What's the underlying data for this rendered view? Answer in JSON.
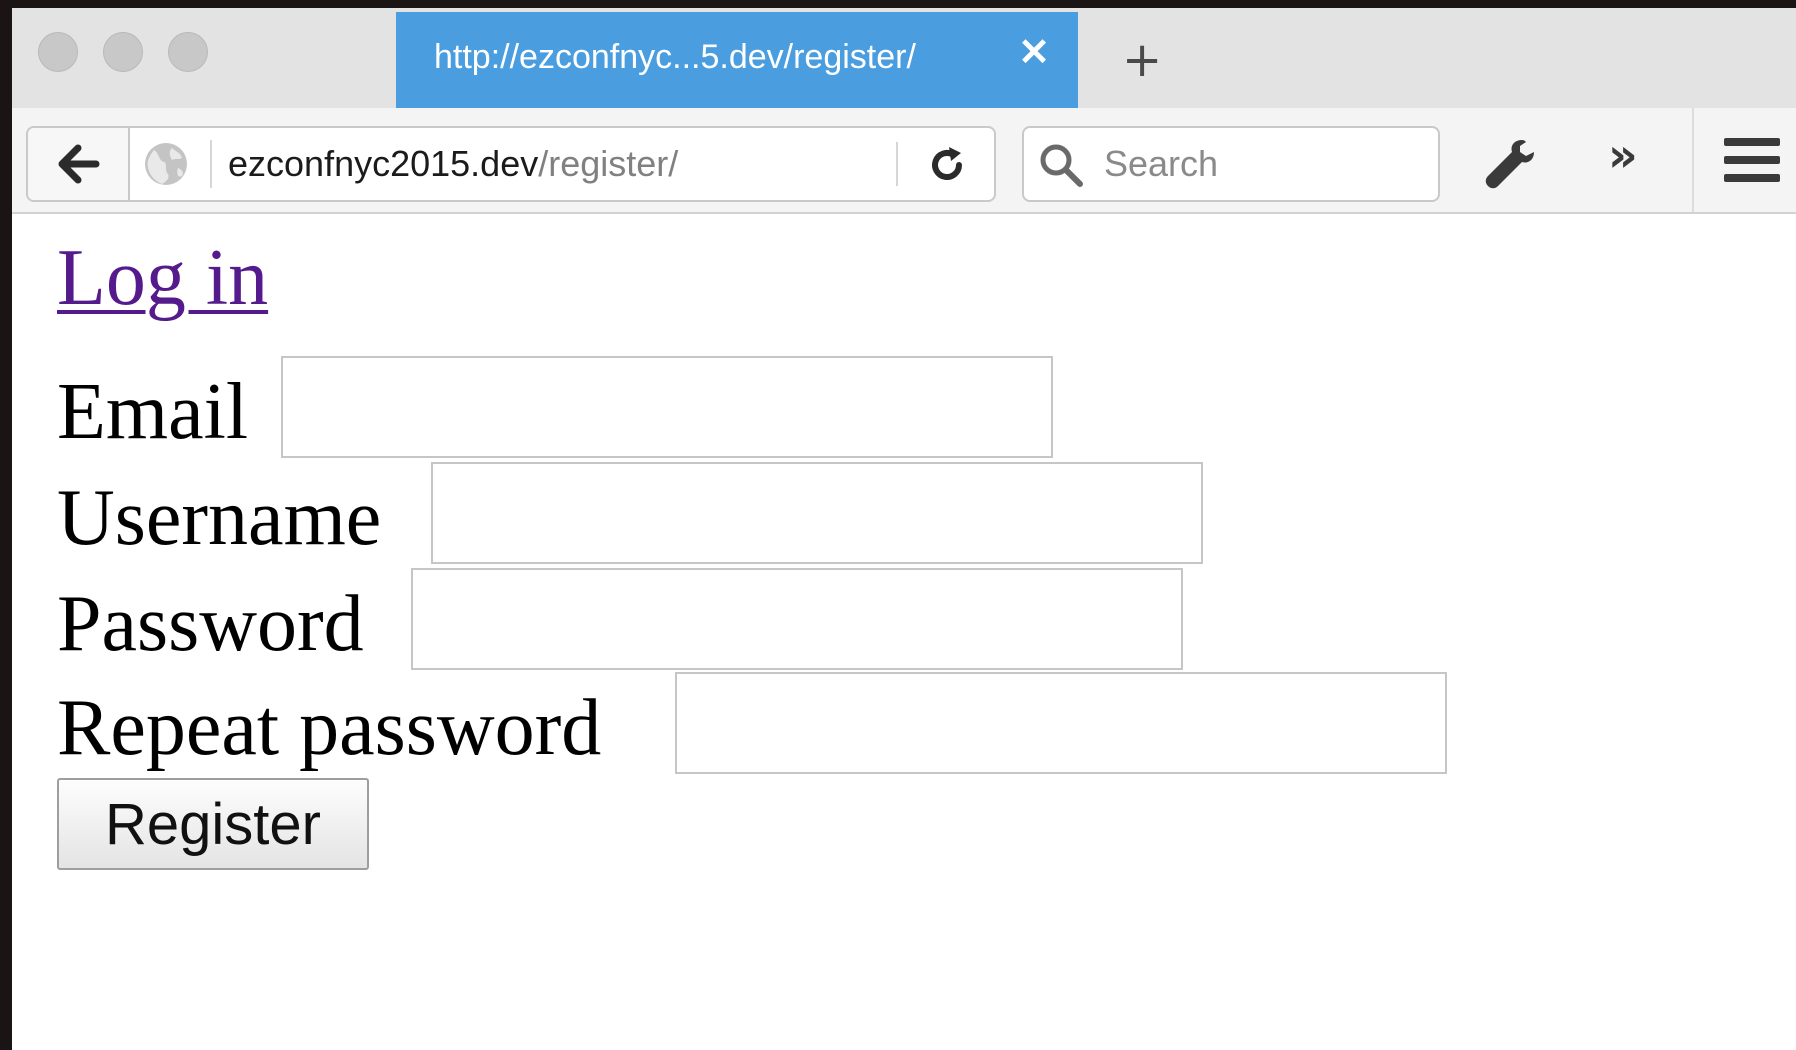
{
  "browser": {
    "tab": {
      "title": "http://ezconfnyc...5.dev/register/",
      "close_glyph": "✕"
    },
    "new_tab_glyph": "+",
    "address": {
      "host": "ezconfnyc2015.dev",
      "path": "/register/"
    },
    "search": {
      "placeholder": "Search"
    },
    "overflow_glyph": "»",
    "colors": {
      "active_tab": "#4a9ee0",
      "visited_link": "#551a8b"
    },
    "icons": [
      "back-arrow-icon",
      "globe-icon",
      "reload-icon",
      "search-icon",
      "wrench-icon",
      "overflow-chevron-icon",
      "hamburger-menu-icon"
    ]
  },
  "page": {
    "login_link": "Log in",
    "form": {
      "email_label": "Email",
      "username_label": "Username",
      "password_label": "Password",
      "repeat_password_label": "Repeat password",
      "email_value": "",
      "username_value": "",
      "password_value": "",
      "repeat_password_value": "",
      "submit_label": "Register"
    }
  }
}
